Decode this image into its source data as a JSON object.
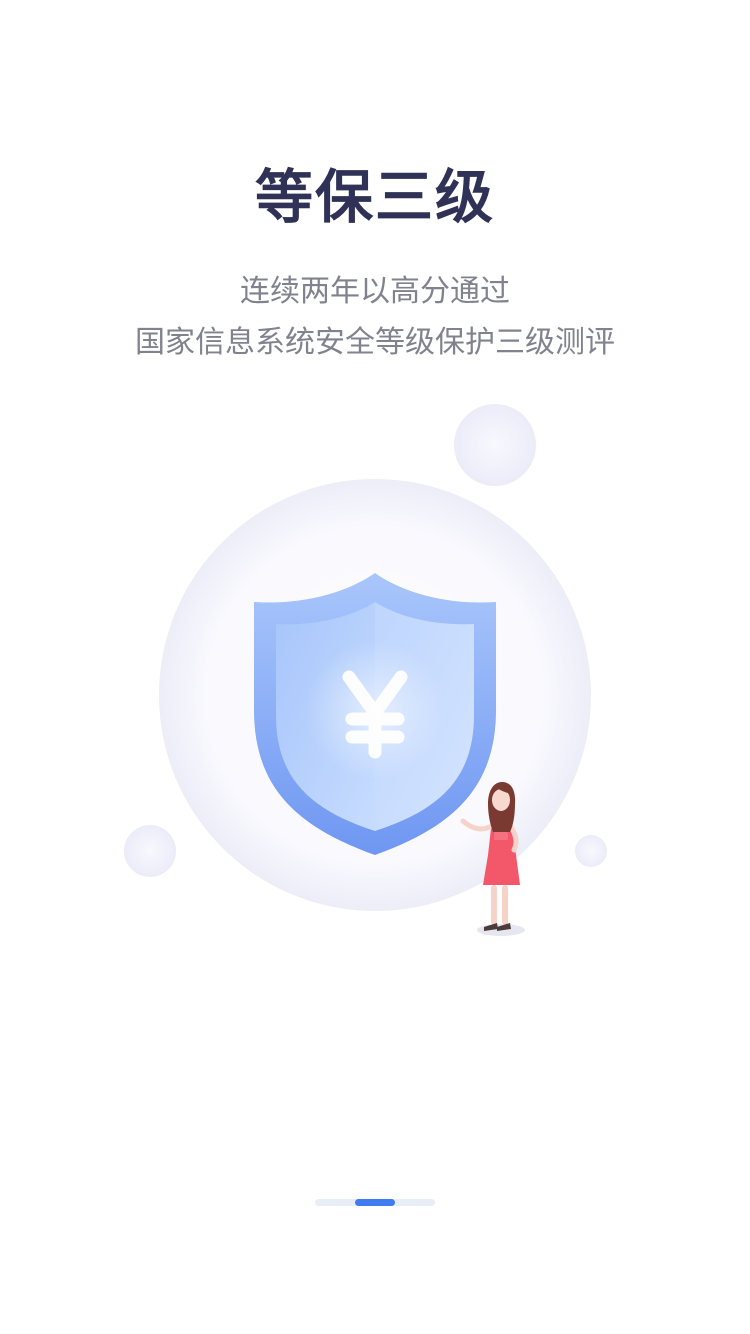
{
  "intro": {
    "title": "等保三级",
    "subtitle_line1": "连续两年以高分通过",
    "subtitle_line2": "国家信息系统安全等级保护三级测评"
  },
  "illustration": {
    "shield_icon": "shield-yen-icon",
    "currency_symbol": "¥",
    "person": "woman-presenting-illustration",
    "colors": {
      "shield_outer": "#7aa5f7",
      "shield_inner": "#b9d3fd",
      "bubble": "#f1f2fb",
      "dress": "#f2586a"
    }
  },
  "pager": {
    "page_count": 3,
    "active_index": 1,
    "active_color": "#3f7cf2",
    "track_color": "#e9edf6"
  }
}
